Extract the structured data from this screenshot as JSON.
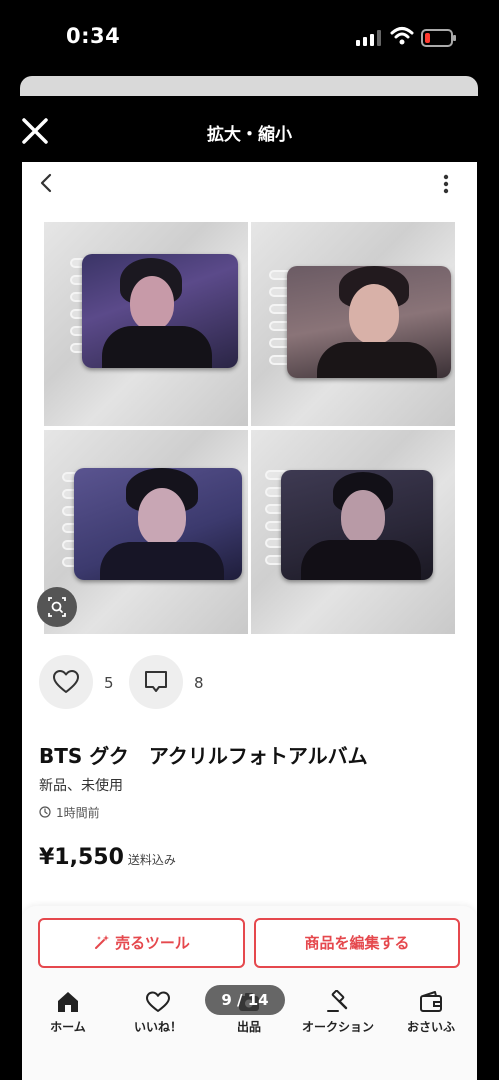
{
  "status_bar": {
    "time": "0:34"
  },
  "modal": {
    "title": "拡大・縮小"
  },
  "product": {
    "title": "BTS グク　アクリルフォトアルバム",
    "condition": "新品、未使用",
    "posted": "1時間前",
    "price": "¥1,550",
    "shipping": "送料込み",
    "likes": "5",
    "comments": "8"
  },
  "actions": {
    "sell_tool": "売るツール",
    "edit_item": "商品を編集する"
  },
  "tabbar": [
    {
      "label": "ホーム",
      "icon": "home-icon"
    },
    {
      "label": "いいね！",
      "icon": "heart-icon"
    },
    {
      "label": "出品",
      "icon": "camera-icon"
    },
    {
      "label": "オークション",
      "icon": "gavel-icon"
    },
    {
      "label": "おさいふ",
      "icon": "wallet-icon"
    }
  ],
  "viewer": {
    "page_indicator": "9 / 14"
  },
  "colors": {
    "accent": "#e5484d",
    "header": "#000000"
  }
}
